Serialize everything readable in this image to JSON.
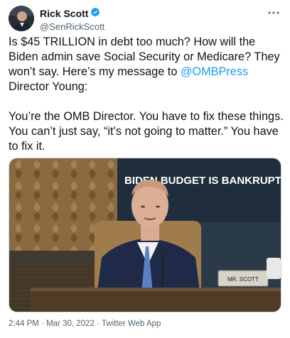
{
  "author": {
    "display_name": "Rick Scott",
    "handle": "@SenRickScott",
    "verified": true
  },
  "icons": {
    "verified": "verified-badge-icon",
    "more": "more-options-icon"
  },
  "tweet": {
    "text_before_mention": "Is $45 TRILLION in debt too much? How will the Biden admin save Social Security or Medicare? They won’t say. Here’s my message to ",
    "mention": "@OMBPress",
    "text_after_mention": " Director Young:\n\nYou’re the OMB Director. You have to fix these things. You can’t just say, “it’s not going to matter.” You have to fix it."
  },
  "media": {
    "banner_text": "BIDEN BUDGET IS BANKRUPTING AMERICA",
    "nameplate": "MR. SCOTT"
  },
  "meta": {
    "time": "2:44 PM",
    "date": "Mar 30, 2022",
    "source": "Twitter Web App",
    "separator": "·"
  },
  "colors": {
    "link": "#1d9bf0",
    "verified": "#1d9bf0",
    "secondary_text": "#536471"
  }
}
